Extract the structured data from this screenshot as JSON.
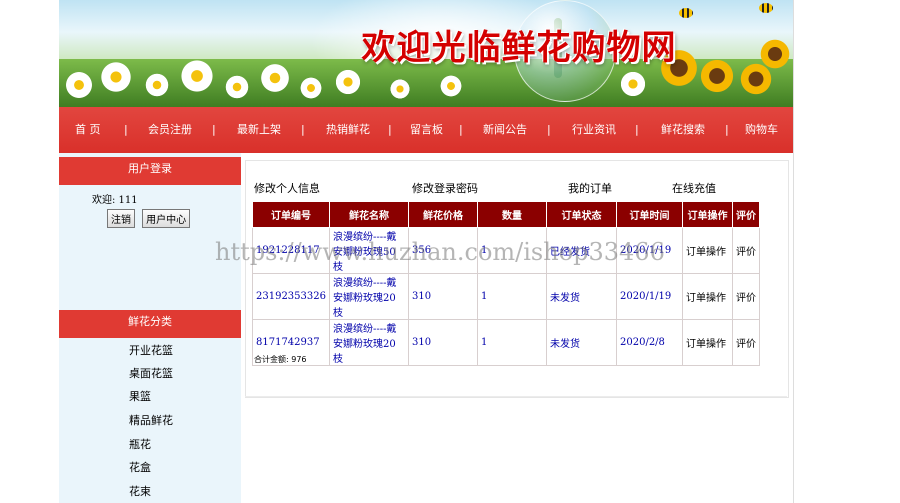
{
  "banner": {
    "title": "欢迎光临鲜花购物网"
  },
  "nav": {
    "items": [
      "首  页",
      "会员注册",
      "最新上架",
      "热销鲜花",
      "留言板",
      "新闻公告",
      "行业资讯",
      "鲜花搜索",
      "购物车"
    ],
    "separator": "|"
  },
  "sidebar": {
    "login_title": "用户登录",
    "welcome": "欢迎: 111",
    "logout_label": "注销",
    "user_center_label": "用户中心",
    "category_title": "鲜花分类",
    "categories": [
      "开业花篮",
      "桌面花篮",
      "果篮",
      "精品鲜花",
      "瓶花",
      "花盒",
      "花束"
    ]
  },
  "main": {
    "links": [
      "修改个人信息",
      "修改登录密码",
      "我的订单",
      "在线充值"
    ],
    "columns": [
      "订单编号",
      "鲜花名称",
      "鲜花价格",
      "数量",
      "订单状态",
      "订单时间",
      "订单操作",
      "评价"
    ],
    "rows": [
      {
        "id": "1921228117",
        "name": "浪漫缤纷----戴安娜粉玫瑰50枝",
        "price": "356",
        "qty": "1",
        "status": "已经发货",
        "time": "2020/1/19",
        "op": "订单操作",
        "review": "评价"
      },
      {
        "id": "23192353326",
        "name": "浪漫缤纷----戴安娜粉玫瑰20枝",
        "price": "310",
        "qty": "1",
        "status": "未发货",
        "time": "2020/1/19",
        "op": "订单操作",
        "review": "评价"
      },
      {
        "id": "8171742937",
        "name": "浪漫缤纷----戴安娜粉玫瑰20枝",
        "price": "310",
        "qty": "1",
        "status": "未发货",
        "time": "2020/2/8",
        "op": "订单操作",
        "review": "评价"
      }
    ],
    "total": "合计金额:   976"
  },
  "watermark": "https://www.huzhan.com/ishop33466"
}
